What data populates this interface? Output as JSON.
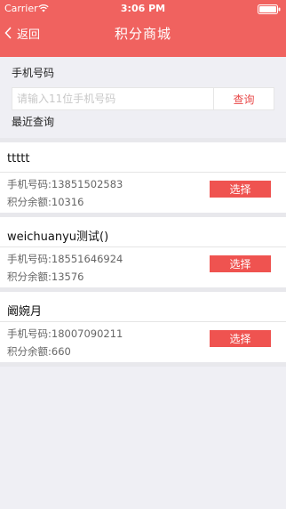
{
  "status_bar": {
    "carrier": "Carrier",
    "time": "3:06 PM"
  },
  "nav": {
    "back_label": "返回",
    "title": "积分商城"
  },
  "search": {
    "label": "手机号码",
    "placeholder": "请输入11位手机号码",
    "value": "",
    "button_label": "查询",
    "recent_label": "最近查询"
  },
  "records": [
    {
      "name": "ttttt",
      "phone": "手机号码:13851502583",
      "points": "积分余额:10316",
      "button_label": "选择"
    },
    {
      "name": "weichuanyu测试()",
      "phone": "手机号码:18551646924",
      "points": "积分余额:13576",
      "button_label": "选择"
    },
    {
      "name": "阚婉月",
      "phone": "手机号码:18007090211",
      "points": "积分余额:660",
      "button_label": "选择"
    }
  ],
  "colors": {
    "accent": "#f0625f",
    "button": "#ef5350",
    "background": "#efeff4"
  }
}
